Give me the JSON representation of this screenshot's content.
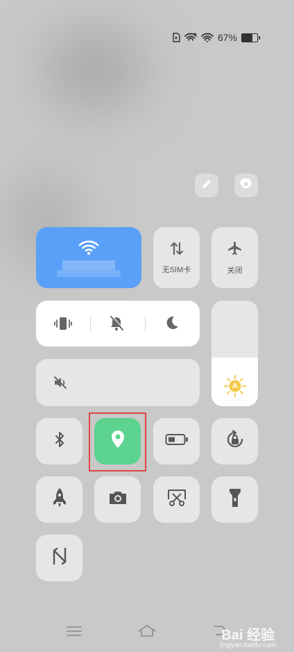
{
  "status_bar": {
    "battery_percent": "67%",
    "battery_level": 0.67,
    "icons": [
      "no-sim-icon",
      "wifi-calling-icon",
      "wifi-icon",
      "battery-icon"
    ]
  },
  "top_actions": {
    "edit_icon": "pencil-icon",
    "settings_icon": "gear-icon"
  },
  "tiles": {
    "wifi": {
      "icon": "wifi-icon",
      "active": true
    },
    "mobile_data": {
      "label": "无SIM卡",
      "icon": "data-arrows-icon"
    },
    "airplane": {
      "label": "关闭",
      "icon": "airplane-icon"
    },
    "sound_modes": [
      "vibrate-icon",
      "mute-bell-icon",
      "do-not-disturb-moon-icon"
    ],
    "volume": {
      "icon": "volume-muted-icon"
    },
    "brightness": {
      "icon": "auto-brightness-icon",
      "badge": "A",
      "level": 0.46
    },
    "row3": [
      "bluetooth-icon",
      "location-icon",
      "battery-saver-icon",
      "rotation-lock-icon"
    ],
    "row4": [
      "rocket-icon",
      "camera-icon",
      "screenshot-icon",
      "flashlight-icon"
    ],
    "row5": [
      "nfc-icon"
    ]
  },
  "colors": {
    "wifi_active": "#5aa0f8",
    "location_active": "#5cd38f",
    "highlight": "#e04444"
  },
  "nav_bar": [
    "menu-icon",
    "home-icon",
    "back-icon"
  ],
  "watermark": {
    "text": "Bai 经验",
    "sub": "jingyan.baidu.com"
  }
}
